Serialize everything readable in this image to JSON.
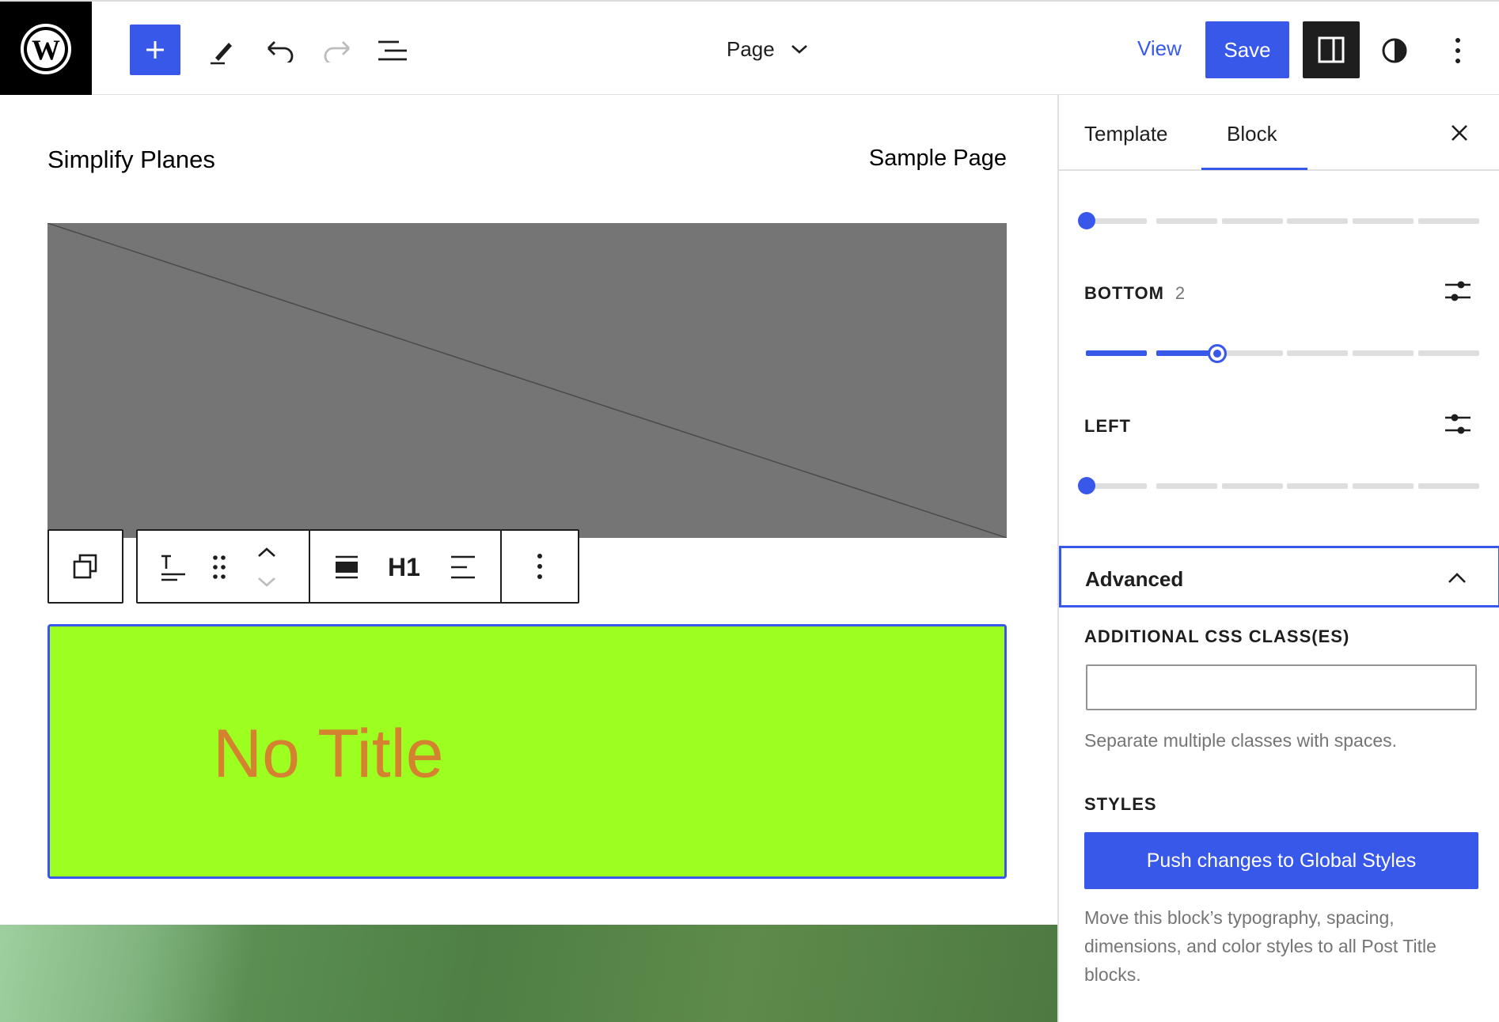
{
  "header": {
    "page_selector": "Page",
    "view_label": "View",
    "save_label": "Save"
  },
  "canvas": {
    "site_title": "Simplify Planes",
    "nav_link": "Sample Page",
    "heading_level": "H1",
    "post_title": "No Title"
  },
  "sidebar": {
    "tabs": [
      {
        "label": "Template"
      },
      {
        "label": "Block",
        "active": true
      }
    ],
    "bottom": {
      "label": "BOTTOM",
      "value": "2"
    },
    "left": {
      "label": "LEFT"
    },
    "advanced_title": "Advanced",
    "css_label": "ADDITIONAL CSS CLASS(ES)",
    "css_value": "",
    "css_help": "Separate multiple classes with spaces.",
    "styles_label": "STYLES",
    "push_button": "Push changes to Global Styles",
    "push_help": "Move this block’s typography, spacing, dimensions, and color styles to all Post Title blocks."
  },
  "colors": {
    "accent": "#3858e9",
    "heading_bg": "#9cff1f",
    "heading_text": "#d4822f"
  }
}
